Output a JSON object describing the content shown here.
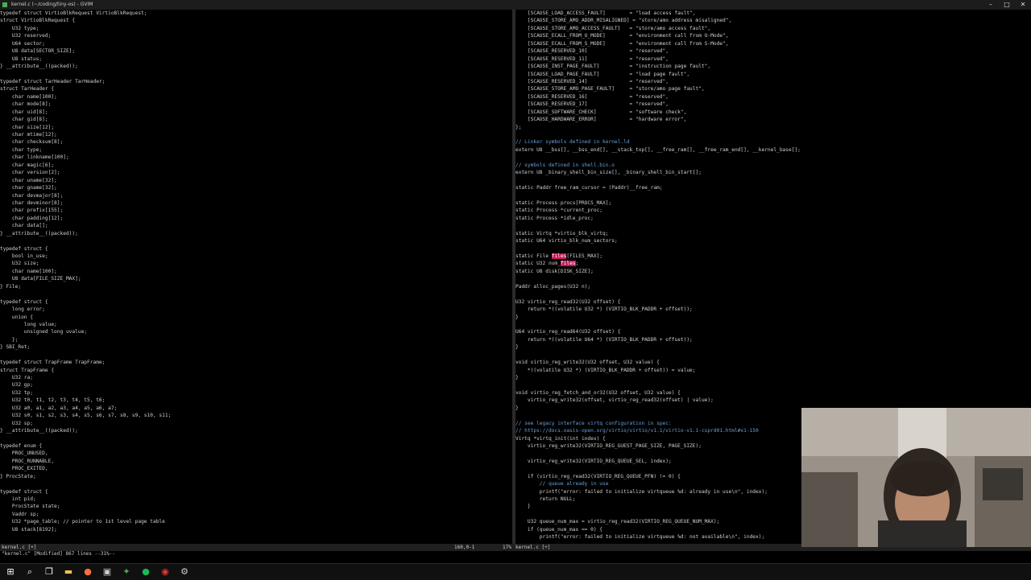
{
  "window": {
    "title": "kernel.c (~/coding/tiny-os) - GVIM",
    "controls": [
      "–",
      "□",
      "✕"
    ]
  },
  "left_pane": {
    "lines": [
      "typedef struct VirtioBlkRequest VirtioBlkRequest;",
      "struct VirtioBlkRequest {",
      "    U32 type;",
      "    U32 reserved;",
      "    U64 sector;",
      "    U8 data[SECTOR_SIZE];",
      "    U8 status;",
      "} __attribute__((packed));",
      "",
      "typedef struct TarHeader TarHeader;",
      "struct TarHeader {",
      "    char name[100];",
      "    char mode[8];",
      "    char uid[8];",
      "    char gid[8];",
      "    char size[12];",
      "    char mtime[12];",
      "    char checksum[8];",
      "    char type;",
      "    char linkname[100];",
      "    char magic[6];",
      "    char version[2];",
      "    char uname[32];",
      "    char gname[32];",
      "    char devmajor[8];",
      "    char devminor[8];",
      "    char prefix[155];",
      "    char padding[12];",
      "    char data[];",
      "} __attribute__((packed));",
      "",
      "typedef struct {",
      "    bool in_use;",
      "    U32 size;",
      "    char name[100];",
      "    U8 data[FILE_SIZE_MAX];",
      "} File;",
      "",
      "typedef struct {",
      "    long error;",
      "    union {",
      "        long value;",
      "        unsigned long uvalue;",
      "    };",
      "} SBI_Ret;",
      "",
      "typedef struct TrapFrame TrapFrame;",
      "struct TrapFrame {",
      "    U32 ra;",
      "    U32 gp;",
      "    U32 tp;",
      "    U32 t0, t1, t2, t3, t4, t5, t6;",
      "    U32 a0, a1, a2, a3, a4, a5, a6, a7;",
      "    U32 s0, s1, s2, s3, s4, s5, s6, s7, s8, s9, s10, s11;",
      "    U32 sp;",
      "} __attribute__((packed));",
      "",
      "typedef enum {",
      "    PROC_UNUSED,",
      "    PROC_RUNNABLE,",
      "    PROC_EXITED,",
      "} ProcState;",
      "",
      "typedef struct {",
      "    int pid;",
      "    ProcState state;",
      "    Vaddr sp;",
      "    U32 *page_table; // pointer to 1st level page table",
      "    U8 stack[8192];"
    ]
  },
  "right_pane": {
    "lines": [
      "    [SCAUSE_LOAD_ACCESS_FAULT]        = \"load access fault\",",
      "    [SCAUSE_STORE_AMO_ADDR_MISALIGNED] = \"store/amo address misaligned\",",
      "    [SCAUSE_STORE_AMO_ACCESS_FAULT]   = \"store/amo access fault\",",
      "    [SCAUSE_ECALL_FROM_U_MODE]        = \"environment call from U-Mode\",",
      "    [SCAUSE_ECALL_FROM_S_MODE]        = \"environment call from S-Mode\",",
      "    [SCAUSE_RESERVED_10]              = \"reserved\",",
      "    [SCAUSE_RESERVED_11]              = \"reserved\",",
      "    [SCAUSE_INST_PAGE_FAULT]          = \"instruction page fault\",",
      "    [SCAUSE_LOAD_PAGE_FAULT]          = \"load page fault\",",
      "    [SCAUSE_RESERVED_14]              = \"reserved\",",
      "    [SCAUSE_STORE_AMO_PAGE_FAULT]     = \"store/amo page fault\",",
      "    [SCAUSE_RESERVED_16]              = \"reserved\",",
      "    [SCAUSE_RESERVED_17]              = \"reserved\",",
      "    [SCAUSE_SOFTWARE_CHECK]           = \"software check\",",
      "    [SCAUSE_HARDWARE_ERROR]           = \"hardware error\",",
      "};",
      "",
      "// Linker symbols defined in kernel.ld",
      "extern U8 __bss[], __bss_end[], __stack_top[], __free_ram[], __free_ram_end[], __kernel_base[];",
      "",
      "// symbols defined in shell.bin.o",
      "extern U8 _binary_shell_bin_size[], _binary_shell_bin_start[];",
      "",
      "static Paddr free_ram_cursor = (Paddr)__free_ram;",
      "",
      "static Process procs[PROCS_MAX];",
      "static Process *current_proc;",
      "static Process *idle_proc;",
      "",
      "static Virtq *virtio_blk_virtq;",
      "static U64 virtio_blk_num_sectors;",
      "",
      "static File files[FILES_MAX];",
      "static U32 num_files;",
      "static U8 disk[DISK_SIZE];",
      "",
      "Paddr alloc_pages(U32 n);",
      "",
      "U32 virtio_reg_read32(U32 offset) {",
      "    return *((volatile U32 *) (VIRTIO_BLK_PADDR + offset));",
      "}",
      "",
      "U64 virtio_reg_read64(U32 offset) {",
      "    return *((volatile U64 *) (VIRTIO_BLK_PADDR + offset));",
      "}",
      "",
      "void virtio_reg_write32(U32 offset, U32 value) {",
      "    *((volatile U32 *) (VIRTIO_BLK_PADDR + offset)) = value;",
      "}",
      "",
      "void virtio_reg_fetch_and_or32(U32 offset, U32 value) {",
      "    virtio_reg_write32(offset, virtio_reg_read32(offset) | value);",
      "}",
      "",
      "// see legacy interface virtq configuration in spec:",
      "// https://docs.oasis-open.org/virtio/virtio/v1.1/virtio-v1.1-csprd01.html#x1-150",
      "Virtq *virtq_init(int index) {",
      "    virtio_reg_write32(VIRTIO_REG_GUEST_PAGE_SIZE, PAGE_SIZE);",
      "",
      "    virtio_reg_write32(VIRTIO_REG_QUEUE_SEL, index);",
      "",
      "    if (virtio_reg_read32(VIRTIO_REG_QUEUE_PFN) != 0) {",
      "        // queue already in use",
      "        printf(\"error: failed to initialize virtqueue %d: already in use\\n\", index);",
      "        return NULL;",
      "    }",
      "",
      "    U32 queue_num_max = virtio_reg_read32(VIRTIO_REG_QUEUE_NUM_MAX);",
      "    if (queue_num_max == 0) {",
      "        printf(\"error: failed to initialize virtqueue %d: not available\\n\", index);"
    ],
    "highlight": {
      "line_files": 32,
      "word_files": "files",
      "line_num_files": 33,
      "word_num_files": "files"
    }
  },
  "statusbar": {
    "left": "kernel.c [+]",
    "position": "160,0-1",
    "percent": "17%",
    "right": "kernel.c [+]"
  },
  "cmdline": {
    "text": "\"kernel.c\" [Modified] 867 lines --31%--"
  },
  "taskbar": {
    "icons": [
      "windows-start-icon",
      "search-icon",
      "task-view-icon",
      "file-explorer-icon",
      "firefox-icon",
      "terminal-icon",
      "gvim-icon",
      "spotify-icon",
      "chrome-icon",
      "settings-icon"
    ],
    "glyphs": [
      "⊞",
      "⌕",
      "❐",
      "▬",
      "●",
      "▣",
      "✦",
      "●",
      "◉",
      "⚙"
    ],
    "colors": [
      "#ffffff",
      "#ffffff",
      "#ffffff",
      "#f2c14e",
      "#ff7139",
      "#cccccc",
      "#4caf50",
      "#1db954",
      "#e53935",
      "#cccccc"
    ]
  }
}
